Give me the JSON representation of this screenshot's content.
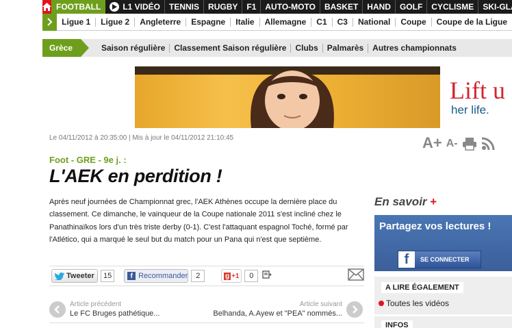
{
  "sports_nav": {
    "items": [
      "FOOTBALL",
      "L1 VIDÉO",
      "TENNIS",
      "RUGBY",
      "F1",
      "AUTO-MOTO",
      "BASKET",
      "HAND",
      "GOLF",
      "CYCLISME",
      "SKI-GLAC"
    ],
    "active": "FOOTBALL"
  },
  "league_nav": {
    "items": [
      "Ligue 1",
      "Ligue 2",
      "Angleterre",
      "Espagne",
      "Italie",
      "Allemagne",
      "C1",
      "C3",
      "National",
      "Coupe",
      "Coupe de la Ligue"
    ]
  },
  "section_nav": {
    "tag": "Grèce",
    "items": [
      "Saison régulière",
      "Classement Saison régulière",
      "Clubs",
      "Palmarès",
      "Autres championnats"
    ]
  },
  "ad": {
    "headline": "Lift u",
    "subline": "her life."
  },
  "article": {
    "dateline": "Le 04/11/2012 à 20:35:00 | Mis à jour le 04/11/2012 21:10:45",
    "kicker": "Foot - GRE - 9e j. :",
    "title": "L'AEK en perdition !",
    "lead": "Après neuf journées de Championnat grec, l'AEK Athènes occupe la dernière place du classement. Ce dimanche, le vainqueur de la Coupe nationale 2011 s'est incliné chez le Panathinaïkos lors d'un très triste derby (0-1). C'est l'attaquant espagnol Toché, formé par l'Atlético, qui a marqué le seul but du match pour un Pana qui n'est que septième."
  },
  "tools": {
    "font_plus": "A+",
    "font_minus": "A-"
  },
  "social": {
    "tweet_label": "Tweeter",
    "tweet_count": "15",
    "fb_label": "Recommander",
    "fb_count": "2",
    "gplus_label": "+1",
    "gplus_count": "0"
  },
  "article_nav": {
    "prev_label": "Article précédent",
    "prev_title": "Le FC Bruges pathétique...",
    "next_label": "Article suivant",
    "next_title": "Belhanda, A.Ayew et \"PEA\" nommés..."
  },
  "sidebar": {
    "en_savoir": "En savoir",
    "en_savoir_plus": "+",
    "fb_box_title": "Partagez vos lectures !",
    "fb_connect": "SE CONNECTER",
    "lire_head": "A LIRE ÉGALEMENT",
    "lire_item": "Toutes les vidéos",
    "infos_head": "INFOS"
  },
  "colors": {
    "accent_green": "#6e9f1c",
    "accent_red": "#e2121f",
    "facebook_blue": "#3b5998"
  }
}
